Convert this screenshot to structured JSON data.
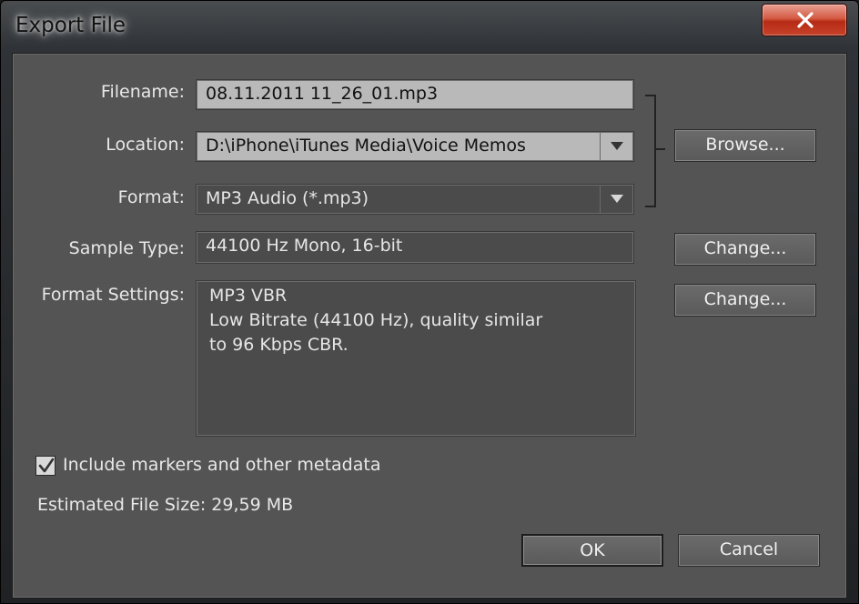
{
  "window": {
    "title": "Export File"
  },
  "labels": {
    "filename": "Filename:",
    "location": "Location:",
    "format": "Format:",
    "sample_type": "Sample Type:",
    "format_settings": "Format Settings:"
  },
  "fields": {
    "filename": "08.11.2011 11_26_01.mp3",
    "location": "D:\\iPhone\\iTunes Media\\Voice Memos",
    "format": "MP3 Audio (*.mp3)",
    "sample_type": "44100 Hz Mono, 16-bit",
    "format_settings_lines": [
      "MP3 VBR",
      "Low Bitrate (44100 Hz), quality similar",
      "to 96 Kbps CBR."
    ]
  },
  "buttons": {
    "browse": "Browse...",
    "change_sample": "Change...",
    "change_format": "Change...",
    "ok": "OK",
    "cancel": "Cancel"
  },
  "checkbox": {
    "label": "Include markers and other metadata",
    "checked": true
  },
  "estimate": "Estimated File Size: 29,59 MB",
  "icons": {
    "close": "close-icon",
    "dropdown": "chevron-down-icon",
    "check": "checkmark-icon"
  }
}
